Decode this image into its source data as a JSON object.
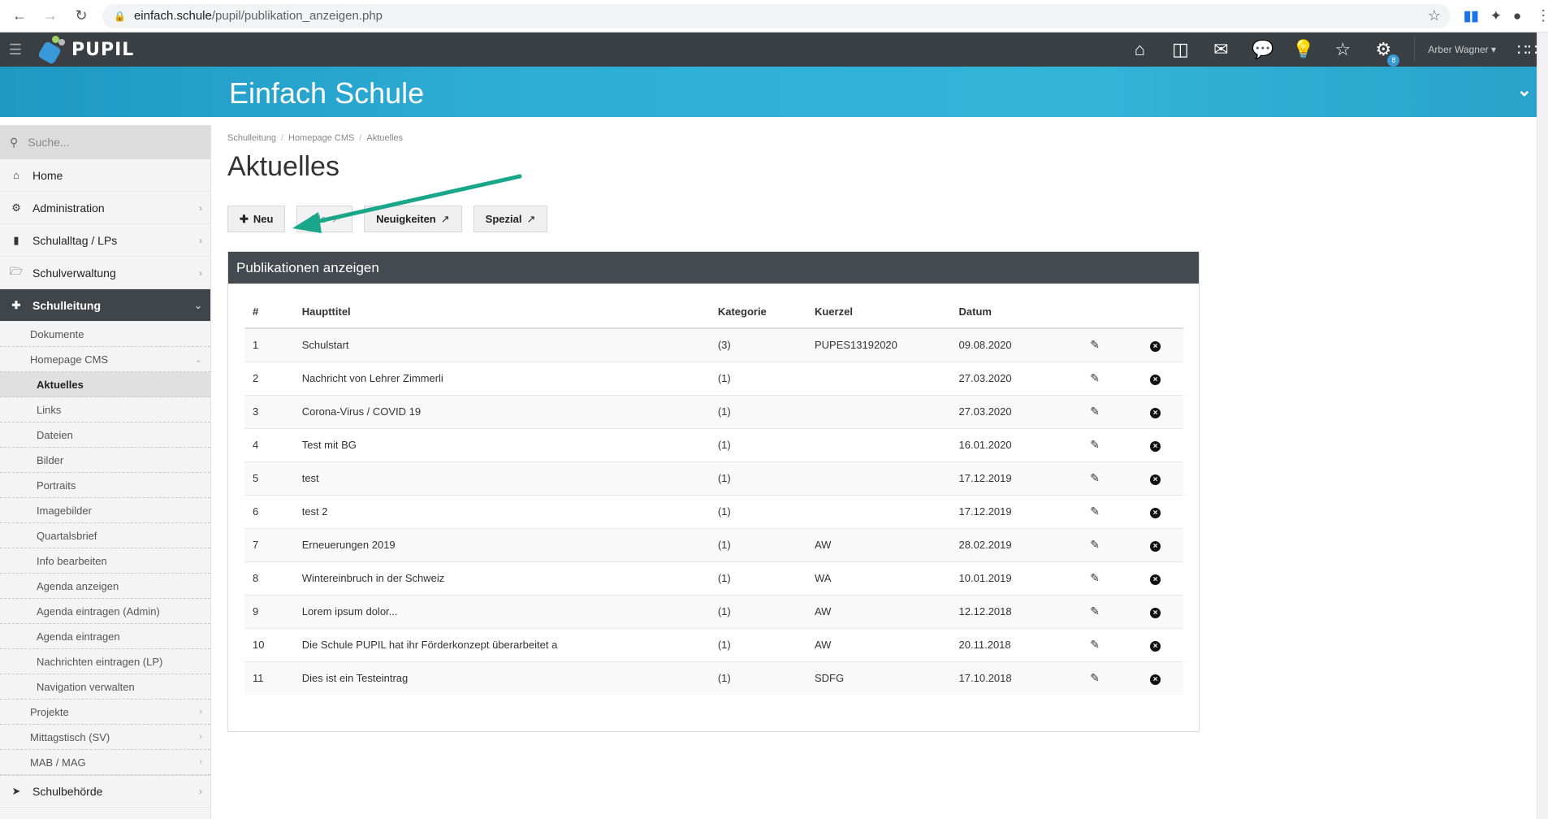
{
  "browser": {
    "url_host": "einfach.schule",
    "url_path": "/pupil/publikation_anzeigen.php"
  },
  "app": {
    "logo_text": "PUPIL",
    "banner_title": "Einfach Schule",
    "user_name": "Arber Wagner",
    "notification_badge": "8"
  },
  "sidebar": {
    "search_placeholder": "Suche...",
    "items": {
      "home": "Home",
      "administration": "Administration",
      "schulalltag": "Schulalltag / LPs",
      "schulverwaltung": "Schulverwaltung",
      "schulleitung": "Schulleitung",
      "schulbehoerde": "Schulbehörde"
    },
    "sub": {
      "dokumente": "Dokumente",
      "homepage_cms": "Homepage CMS",
      "aktuelles": "Aktuelles",
      "links": "Links",
      "dateien": "Dateien",
      "bilder": "Bilder",
      "portraits": "Portraits",
      "imagebilder": "Imagebilder",
      "quartalsbrief": "Quartalsbrief",
      "info_bearbeiten": "Info bearbeiten",
      "agenda_anzeigen": "Agenda anzeigen",
      "agenda_eintragen_admin": "Agenda eintragen (Admin)",
      "agenda_eintragen": "Agenda eintragen",
      "nachrichten_eintragen": "Nachrichten eintragen (LP)",
      "navigation_verwalten": "Navigation verwalten",
      "projekte": "Projekte",
      "mittagstisch": "Mittagstisch (SV)",
      "mab": "MAB / MAG"
    }
  },
  "breadcrumb": [
    "Schulleitung",
    "Homepage CMS",
    "Aktuelles"
  ],
  "page_title": "Aktuelles",
  "buttons": {
    "neu": "Neu",
    "alle": "Alle",
    "neuigkeiten": "Neuigkeiten",
    "spezial": "Spezial"
  },
  "panel_title": "Publikationen anzeigen",
  "table": {
    "headers": [
      "#",
      "Haupttitel",
      "Kategorie",
      "Kuerzel",
      "Datum"
    ],
    "rows": [
      [
        "1",
        "Schulstart",
        "(3)",
        "PUPES13192020",
        "09.08.2020"
      ],
      [
        "2",
        "Nachricht von Lehrer Zimmerli",
        "(1)",
        "",
        "27.03.2020"
      ],
      [
        "3",
        "Corona-Virus / COVID 19",
        "(1)",
        "",
        "27.03.2020"
      ],
      [
        "4",
        "Test mit BG",
        "(1)",
        "",
        "16.01.2020"
      ],
      [
        "5",
        "test",
        "(1)",
        "",
        "17.12.2019"
      ],
      [
        "6",
        "test 2",
        "(1)",
        "",
        "17.12.2019"
      ],
      [
        "7",
        "Erneuerungen 2019",
        "(1)",
        "AW",
        "28.02.2019"
      ],
      [
        "8",
        "Wintereinbruch in der Schweiz",
        "(1)",
        "WA",
        "10.01.2019"
      ],
      [
        "9",
        "Lorem ipsum dolor...",
        "(1)",
        "AW",
        "12.12.2018"
      ],
      [
        "10",
        "Die Schule PUPIL hat ihr Förderkonzept überarbeitet a",
        "(1)",
        "AW",
        "20.11.2018"
      ],
      [
        "11",
        "Dies ist ein Testeintrag",
        "(1)",
        "SDFG",
        "17.10.2018"
      ]
    ]
  },
  "colors": {
    "topbar": "#3a3f44",
    "banner": "#2eaed6",
    "arrow": "#1aa68a",
    "panel_header": "#454a50"
  }
}
